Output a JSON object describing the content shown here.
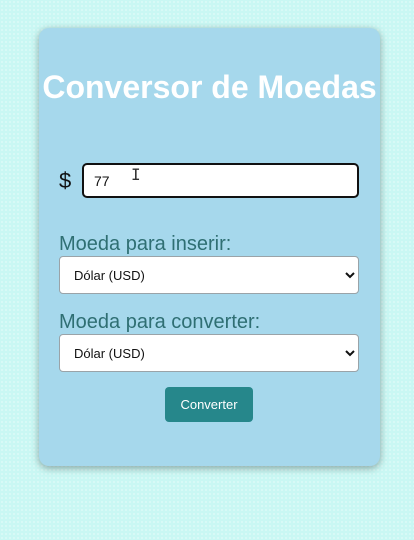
{
  "app": {
    "title": "Conversor de Moedas"
  },
  "amount": {
    "symbol": "$",
    "value": "77"
  },
  "from_currency": {
    "label": "Moeda para inserir:",
    "selected": "Dólar (USD)"
  },
  "to_currency": {
    "label": "Moeda para converter:",
    "selected": "Dólar (USD)"
  },
  "actions": {
    "convert_label": "Converter"
  },
  "cursor": {
    "glyph": "I"
  },
  "colors": {
    "background": "#c9f7f3",
    "card": "#a6d8ec",
    "label": "#2f6f73",
    "button": "#26878b"
  }
}
